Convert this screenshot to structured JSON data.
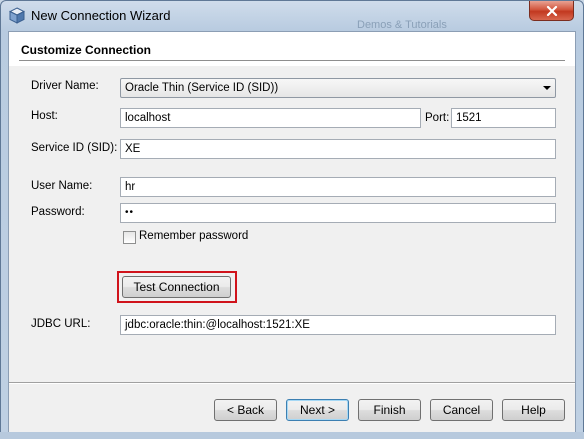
{
  "window": {
    "title": "New Connection Wizard",
    "background_hint": "Demos & Tutorials"
  },
  "section": {
    "title": "Customize Connection"
  },
  "form": {
    "driver_label": "Driver Name:",
    "driver_value": "Oracle Thin (Service ID (SID))",
    "host_label": "Host:",
    "host_value": "localhost",
    "port_label": "Port:",
    "port_value": "1521",
    "sid_label": "Service ID (SID):",
    "sid_value": "XE",
    "username_label": "User Name:",
    "username_value": "hr",
    "password_label": "Password:",
    "password_value": "••",
    "remember_label": "Remember password",
    "remember_checked": false,
    "test_button_label": "Test Connection",
    "jdbc_label": "JDBC URL:",
    "jdbc_value": "jdbc:oracle:thin:@localhost:1521:XE"
  },
  "footer": {
    "back_label": "< Back",
    "next_label": "Next >",
    "finish_label": "Finish",
    "cancel_label": "Cancel",
    "help_label": "Help"
  },
  "colors": {
    "highlight": "#d0131b",
    "close_button": "#c2381f"
  },
  "icons": {
    "app": "netbeans-cube-icon",
    "close": "close-icon",
    "dropdown": "chevron-down-icon"
  }
}
